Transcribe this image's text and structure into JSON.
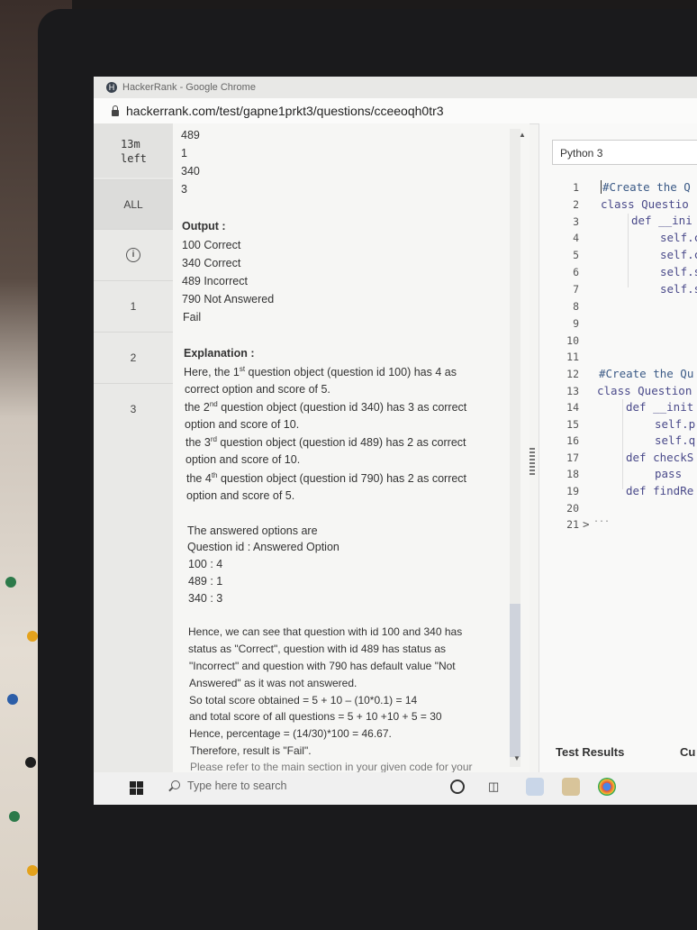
{
  "browser": {
    "title": "HackerRank - Google Chrome",
    "url": "hackerrank.com/test/gapne1prkt3/questions/cceeoqh0tr3"
  },
  "nav": {
    "time_value": "13m",
    "time_label": "left",
    "all_label": "ALL",
    "info_icon_glyph": "i",
    "questions": [
      "1",
      "2",
      "3"
    ]
  },
  "content": {
    "input_lines": [
      "489",
      "1",
      "340",
      "3"
    ],
    "output_heading": "Output :",
    "output_lines": [
      "100 Correct",
      "340 Correct",
      "489 Incorrect",
      "790 Not Answered",
      "Fail"
    ],
    "explanation_heading": "Explanation :",
    "explanation": {
      "l1a": "Here, the 1",
      "l1s": "st",
      "l1b": " question object (question id 100) has 4 as",
      "l2": "correct option and score of 5.",
      "l3a": "the 2",
      "l3s": "nd",
      "l3b": " question object (question id 340) has 3 as correct",
      "l4": "option and score of 10.",
      "l5a": "the 3",
      "l5s": "rd",
      "l5b": " question object (question id 489) has 2 as correct",
      "l6": "option and score of 10.",
      "l7a": "the 4",
      "l7s": "th",
      "l7b": " question object (question id 790) has 2 as correct",
      "l8": "option and score of 5."
    },
    "answered_heading": "The answered options are",
    "answered_subheading": "Question id : Answered Option",
    "answered_lines": [
      "100 : 4",
      "489 : 1",
      "340 : 3"
    ],
    "summary_lines": [
      "Hence, we can see that question with id 100 and 340 has",
      "status as \"Correct\", question with id 489 has status as",
      "\"Incorrect\" and question with 790 has default value \"Not",
      "Answered\" as it was not answered.",
      "So total score obtained = 5 + 10 – (10*0.1) = 14",
      "and total score of all questions = 5 + 10 +10 + 5 = 30",
      "Hence, percentage = (14/30)*100 = 46.67.",
      "Therefore, result is \"Fail\".",
      "Please refer to the main section in your given code for your"
    ]
  },
  "editor": {
    "language": "Python 3",
    "line_numbers": [
      "1",
      "2",
      "3",
      "4",
      "5",
      "6",
      "7",
      "8",
      "9",
      "10",
      "11",
      "12",
      "13",
      "14",
      "15",
      "16",
      "17",
      "18",
      "19",
      "20",
      "21"
    ],
    "fold_marker": ">",
    "code": {
      "l1": "#Create the Q",
      "l2": "class Questio",
      "l3": "def __ini",
      "l4": "self.c",
      "l5": "self.c",
      "l6": "self.s",
      "l7": "self.s",
      "l12": "#Create the Qu",
      "l13": "class Question",
      "l14": "def __init",
      "l15": "self.p",
      "l16": "self.q",
      "l17": "def checkS",
      "l18": "pass",
      "l19": "def findRe",
      "l21": "..."
    },
    "test_results_label": "Test Results",
    "custom_label": "Cu"
  },
  "taskbar": {
    "search_placeholder": "Type here to search"
  }
}
